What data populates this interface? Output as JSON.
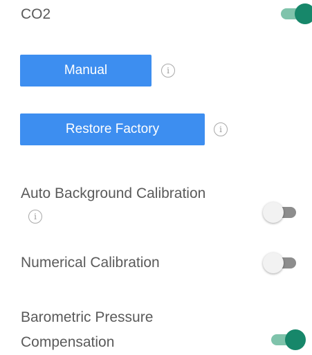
{
  "co2": {
    "label": "CO2",
    "enabled": true
  },
  "manual_button": {
    "label": "Manual",
    "info_glyph": "i"
  },
  "restore_factory_button": {
    "label": "Restore Factory",
    "info_glyph": "i"
  },
  "auto_background_calibration": {
    "label": "Auto Background Calibration",
    "info_glyph": "i",
    "enabled": false
  },
  "numerical_calibration": {
    "label": "Numerical Calibration",
    "enabled": false
  },
  "barometric_pressure_compensation": {
    "label": "Barometric Pressure Compensation",
    "enabled": true
  },
  "colors": {
    "button_blue": "#3d8ef0",
    "toggle_on_thumb": "#17876a",
    "toggle_on_track": "#7fc3ab",
    "toggle_off_thumb": "#f2f2f2",
    "toggle_off_track": "#8d8d8d"
  },
  "icons": {
    "info": "info-circle-icon",
    "toggle": "toggle-switch"
  }
}
